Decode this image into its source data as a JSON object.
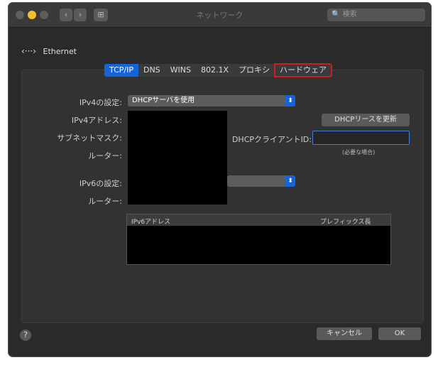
{
  "window": {
    "title": "ネットワーク",
    "search_placeholder": "検索",
    "nav_back": "‹",
    "nav_forward": "›",
    "grid": "⊞",
    "traffic_colors": [
      "#5e5e5e",
      "#f5bd2f",
      "#5e5e5e"
    ]
  },
  "breadcrumb": {
    "icon": "‹···›",
    "label": "Ethernet"
  },
  "tabs": [
    {
      "label": "TCP/IP",
      "active": true
    },
    {
      "label": "DNS"
    },
    {
      "label": "WINS"
    },
    {
      "label": "802.1X"
    },
    {
      "label": "プロキシ"
    },
    {
      "label": "ハードウェア",
      "highlighted": true
    }
  ],
  "form": {
    "ipv4_config_label": "IPv4の設定:",
    "ipv4_config_value": "DHCPサーバを使用",
    "ipv4_address_label": "IPv4アドレス:",
    "subnet_label": "サブネットマスク:",
    "router_label": "ルーター:",
    "ipv6_config_label": "IPv6の設定:",
    "router6_label": "ルーター:",
    "renew_button": "DHCPリースを更新",
    "dhcp_client_label": "DHCPクライアントID:",
    "dhcp_client_hint": "(必要な場合)",
    "popup_arrow": "⬍"
  },
  "table": {
    "col1": "IPv6アドレス",
    "col2": "プレフィックス長"
  },
  "footer": {
    "help": "?",
    "cancel": "キャンセル",
    "ok": "OK"
  },
  "accent": "#1565d8",
  "highlight_outline": "#cc1f1f"
}
